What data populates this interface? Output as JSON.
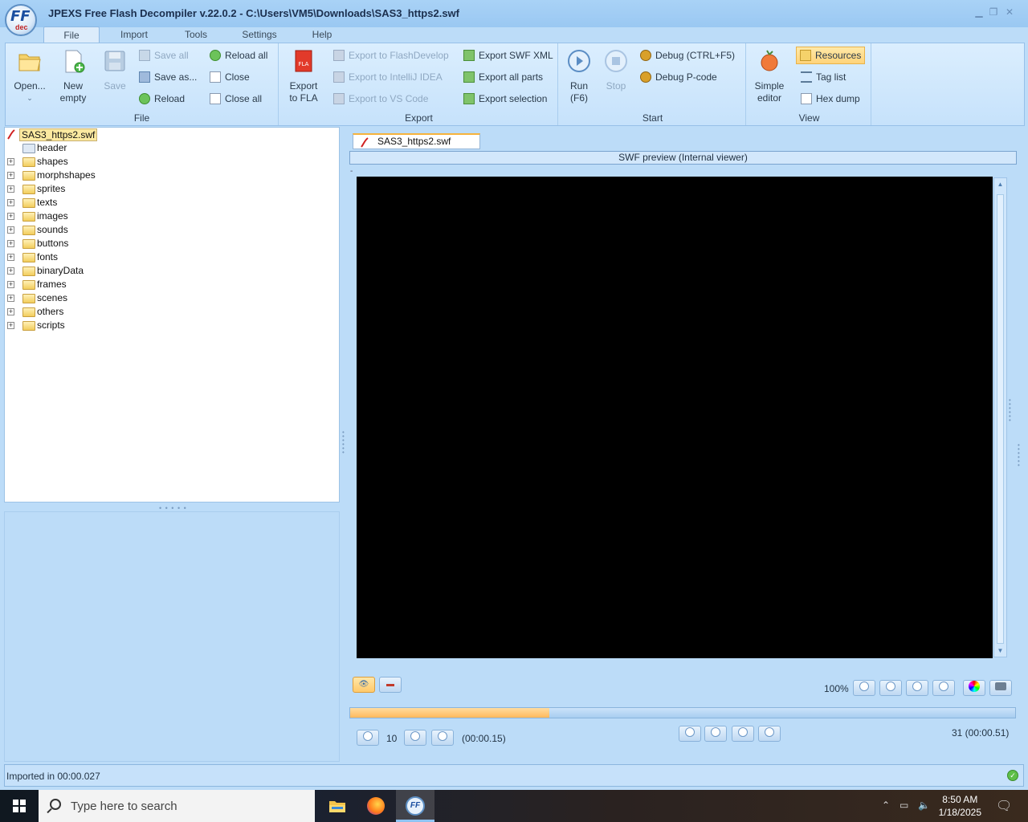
{
  "window": {
    "title": "JPEXS Free Flash Decompiler v.22.0.2 - C:\\Users\\VM5\\Downloads\\SAS3_https2.swf",
    "logo_text": "FF",
    "logo_sub": "dec"
  },
  "menu": {
    "tabs": [
      "File",
      "Import",
      "Tools",
      "Settings",
      "Help"
    ],
    "active": "File"
  },
  "ribbon": {
    "file_group": {
      "label": "File",
      "open": "Open...",
      "new_empty_1": "New",
      "new_empty_2": "empty",
      "save": "Save",
      "save_all": "Save all",
      "save_as": "Save as...",
      "reload": "Reload",
      "reload_all": "Reload all",
      "close": "Close",
      "close_all": "Close all"
    },
    "export_group": {
      "label": "Export",
      "export_fla_1": "Export",
      "export_fla_2": "to FLA",
      "export_flashdevelop": "Export to FlashDevelop",
      "export_intellij": "Export to IntelliJ IDEA",
      "export_vscode": "Export to VS Code",
      "export_swf_xml": "Export SWF XML",
      "export_all_parts": "Export all parts",
      "export_selection": "Export selection"
    },
    "start_group": {
      "label": "Start",
      "run_1": "Run",
      "run_2": "(F6)",
      "stop": "Stop",
      "debug": "Debug (CTRL+F5)",
      "debug_pcode": "Debug P-code"
    },
    "view_group": {
      "label": "View",
      "simple_editor_1": "Simple",
      "simple_editor_2": "editor",
      "resources": "Resources",
      "tag_list": "Tag list",
      "hex_dump": "Hex dump"
    }
  },
  "tree": {
    "root": "SAS3_https2.swf",
    "items": [
      "header",
      "shapes",
      "morphshapes",
      "sprites",
      "texts",
      "images",
      "sounds",
      "buttons",
      "fonts",
      "binaryData",
      "frames",
      "scenes",
      "others",
      "scripts"
    ]
  },
  "preview": {
    "tab_label": "SAS3_https2.swf",
    "header": "SWF preview (Internal viewer)",
    "zoom": "100%",
    "current_frame": "10",
    "current_time": "(00:00.15)",
    "total": "31 (00:00.51)",
    "progress_fraction": 0.3
  },
  "status": {
    "text": "Imported in 00:00.027"
  },
  "taskbar": {
    "search_placeholder": "Type here to search",
    "time": "8:50 AM",
    "date": "1/18/2025"
  },
  "colors": {
    "accent": "#f6b23c",
    "ribbon_bg": "#dbeefe",
    "window_bg": "#bcdcf8"
  }
}
